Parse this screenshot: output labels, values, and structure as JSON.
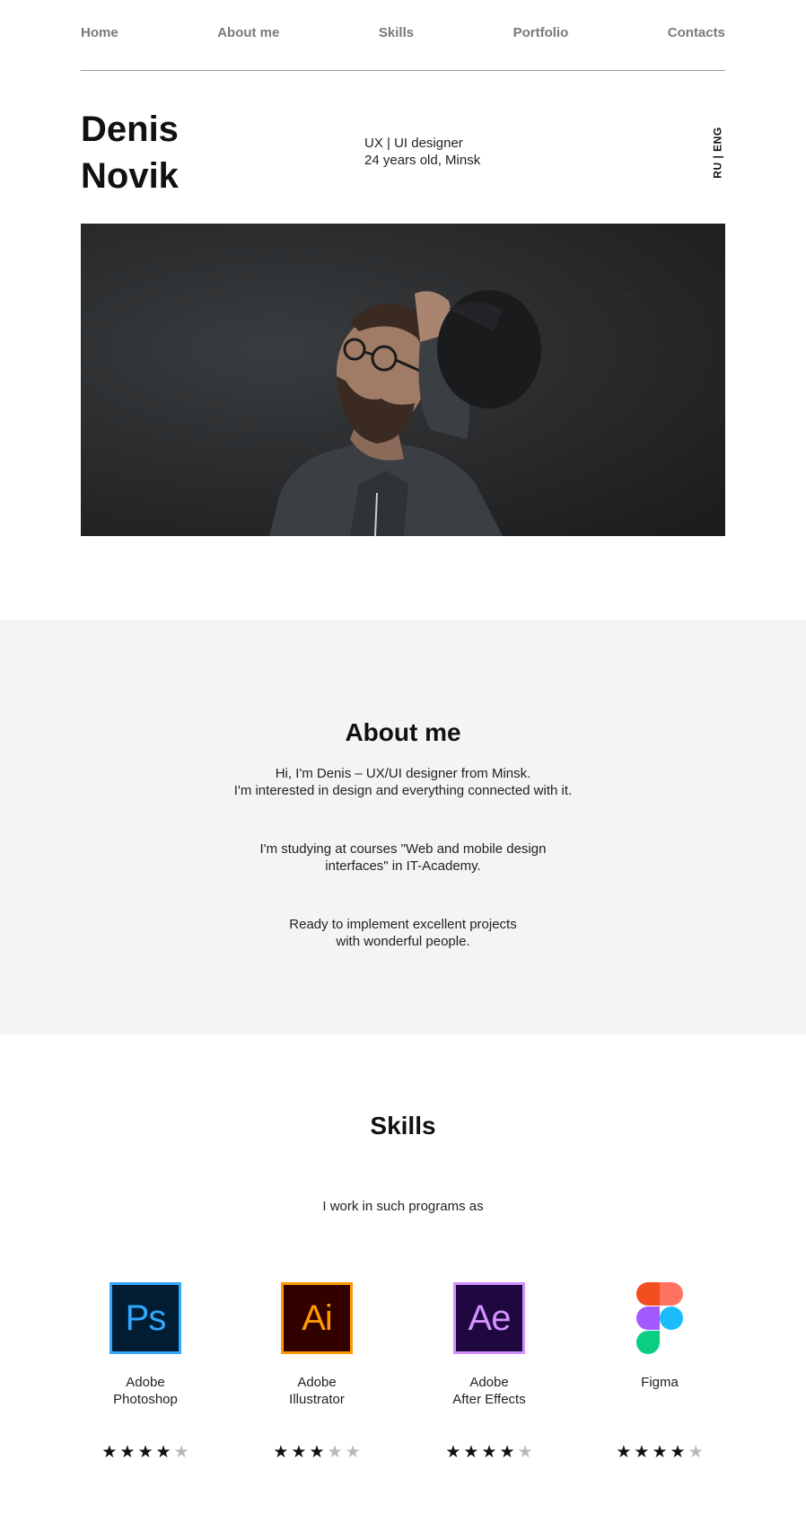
{
  "nav": {
    "items": [
      {
        "label": "Home"
      },
      {
        "label": "About me"
      },
      {
        "label": "Skills"
      },
      {
        "label": "Portfolio"
      },
      {
        "label": "Contacts"
      }
    ]
  },
  "hero": {
    "first_name": "Denis",
    "last_name": "Novik",
    "role": "UX | UI designer",
    "age_city": "24 years old, Minsk",
    "lang": {
      "ru": "RU",
      "sep": " | ",
      "eng": "ENG"
    }
  },
  "about": {
    "title": "About me",
    "paragraphs": [
      [
        "Hi, I'm Denis – UX/UI designer from Minsk.",
        "I'm interested in design and everything connected with it."
      ],
      [
        "I'm studying at courses \"Web and mobile design",
        "interfaces\" in IT-Academy."
      ],
      [
        "Ready to implement excellent projects",
        "with wonderful people."
      ]
    ]
  },
  "skills": {
    "title": "Skills",
    "subtitle": "I work in such programs as",
    "items": [
      {
        "line1": "Adobe",
        "line2": "Photoshop",
        "icon": "photoshop-icon",
        "logo_text": "Ps",
        "bg": "#001d34",
        "accent": "#31a8ff",
        "rating": 4
      },
      {
        "line1": "Adobe",
        "line2": "Illustrator",
        "icon": "illustrator-icon",
        "logo_text": "Ai",
        "bg": "#330000",
        "accent": "#ff9a00",
        "rating": 3
      },
      {
        "line1": "Adobe",
        "line2": "After Effects",
        "icon": "after-effects-icon",
        "logo_text": "Ae",
        "bg": "#1f0740",
        "accent": "#d291ff",
        "rating": 4
      },
      {
        "line1": "Figma",
        "line2": "",
        "icon": "figma-icon",
        "logo_text": "",
        "bg": "",
        "accent": "",
        "rating": 4
      }
    ],
    "max_rating": 5
  },
  "colors": {
    "nav_text": "#7a7a7a",
    "about_bg": "#f4f4f4",
    "star_on": "#111111",
    "star_off": "#b9b9b9"
  }
}
